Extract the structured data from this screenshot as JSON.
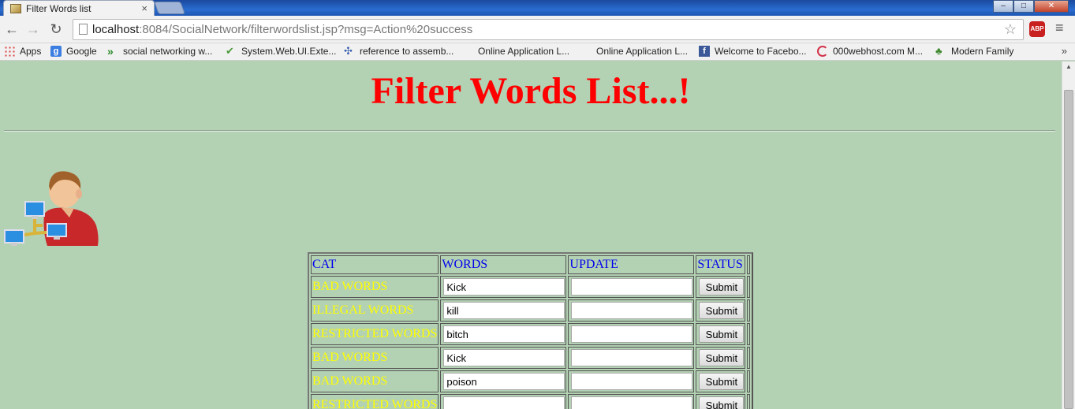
{
  "browser": {
    "tab_title": "Filter Words list",
    "tab_close": "×",
    "window_controls": {
      "minimize": "–",
      "maximize": "□",
      "close": "✕"
    }
  },
  "toolbar": {
    "back": "←",
    "forward": "→",
    "reload": "↻",
    "url_host": "localhost",
    "url_path": ":8084/SocialNetwork/filterwordslist.jsp?msg=Action%20success",
    "star": "☆",
    "abp": "ABP",
    "menu": "≡"
  },
  "bookmarks": {
    "items": [
      {
        "label": "Apps",
        "icon": "apps-grid-icon"
      },
      {
        "label": "Google",
        "icon": "google-icon"
      },
      {
        "label": "social networking w...",
        "icon": "double-chevron-icon"
      },
      {
        "label": "System.Web.UI.Exte...",
        "icon": "checkmark-icon"
      },
      {
        "label": "reference to assemb...",
        "icon": "puzzle-icon"
      },
      {
        "label": "Online Application L...",
        "icon": ""
      },
      {
        "label": "Online Application L...",
        "icon": ""
      },
      {
        "label": "Welcome to Facebo...",
        "icon": "facebook-icon"
      },
      {
        "label": "000webhost.com M...",
        "icon": "swirl-icon"
      },
      {
        "label": "Modern Family",
        "icon": "tree-icon"
      }
    ],
    "more": "»"
  },
  "page": {
    "title": "Filter Words List...!",
    "table": {
      "headers": [
        "CAT",
        "WORDS",
        "UPDATE",
        "STATUS"
      ],
      "submit_label": "Submit",
      "rows": [
        {
          "cat": "BAD WORDS",
          "word": "Kick",
          "update": ""
        },
        {
          "cat": "ILLEGAL WORDS",
          "word": "kill",
          "update": ""
        },
        {
          "cat": "RESTRICTED WORDS",
          "word": "bitch",
          "update": ""
        },
        {
          "cat": "BAD WORDS",
          "word": "Kick",
          "update": ""
        },
        {
          "cat": "BAD WORDS",
          "word": "poison",
          "update": ""
        },
        {
          "cat": "RESTRICTED WORDS",
          "word": "",
          "update": ""
        }
      ]
    }
  },
  "colors": {
    "page_bg": "#b3d1b3",
    "title": "#ff0000",
    "header_text": "#0000ee",
    "category_text": "#ffff00"
  }
}
